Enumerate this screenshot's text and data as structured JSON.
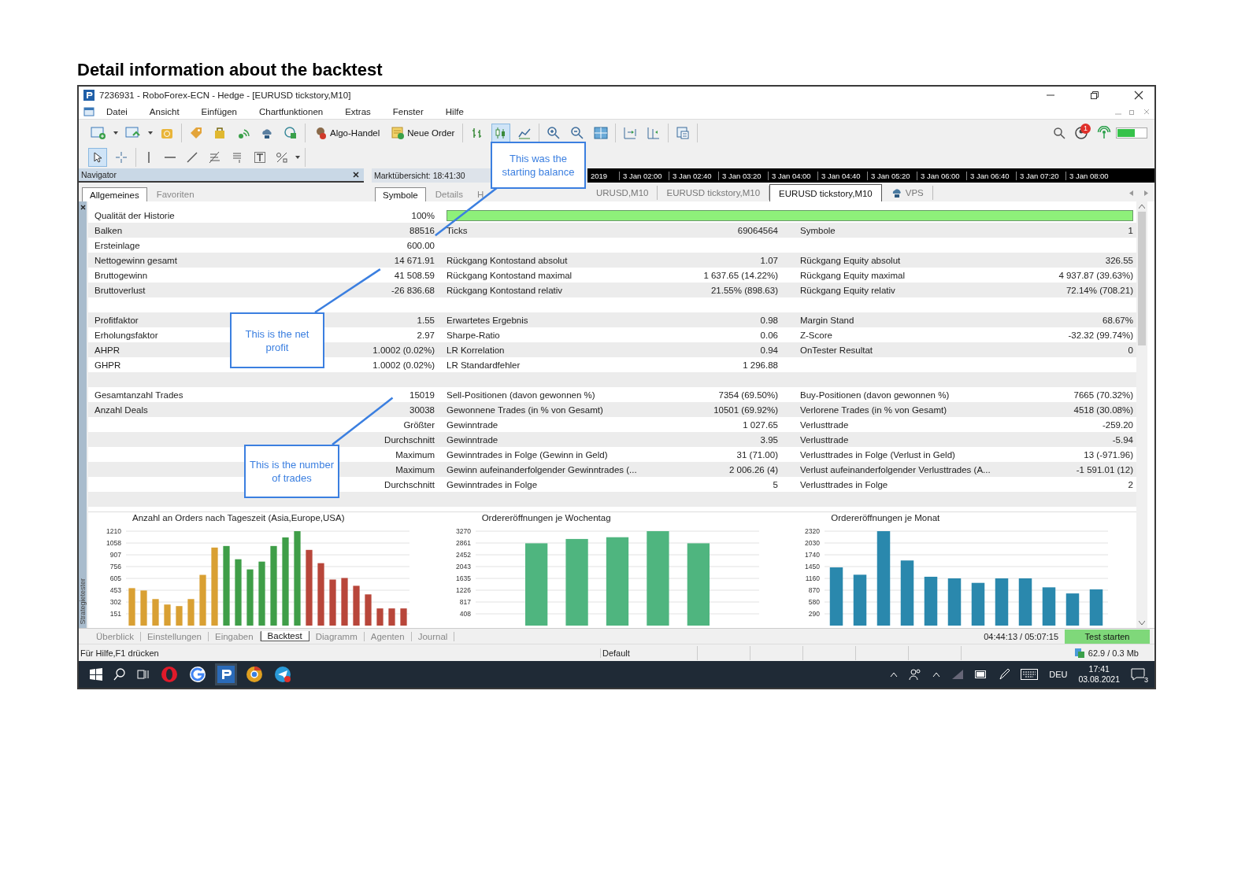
{
  "heading": "Detail information about the backtest",
  "window": {
    "title": "7236931 - RoboForex-ECN - Hedge - [EURUSD tickstory,M10]"
  },
  "menu": [
    "Datei",
    "Ansicht",
    "Einfügen",
    "Chartfunktionen",
    "Extras",
    "Fenster",
    "Hilfe"
  ],
  "toolbar": {
    "buttons": [
      {
        "label": "Algo-Handel"
      },
      {
        "label": "Neue Order"
      }
    ],
    "chart_modes": [
      {
        "selected": false
      },
      {
        "selected": true
      },
      {
        "selected": false
      }
    ],
    "notification_count": "1"
  },
  "drawing_tools": [
    {
      "selected": true
    },
    {
      "selected": false
    }
  ],
  "navigator": {
    "title": "Navigator",
    "tabs": [
      {
        "label": "Allgemeines",
        "selected": true
      },
      {
        "label": "Favoriten",
        "selected": false
      }
    ]
  },
  "market_watch": {
    "title": "Marktübersicht: 18:41:30",
    "tabs": [
      {
        "label": "Symbole",
        "selected": true
      },
      {
        "label": "Details",
        "selected": false
      },
      {
        "label": "H",
        "selected": false
      }
    ]
  },
  "timeline": [
    "2019",
    "3 Jan 02:00",
    "3 Jan 02:40",
    "3 Jan 03:20",
    "3 Jan 04:00",
    "3 Jan 04:40",
    "3 Jan 05:20",
    "3 Jan 06:00",
    "3 Jan 06:40",
    "3 Jan 07:20",
    "3 Jan 08:00"
  ],
  "chart_tabs": [
    {
      "label": "URUSD,M10",
      "selected": false
    },
    {
      "label": "EURUSD tickstory,M10",
      "selected": false
    },
    {
      "label": "EURUSD tickstory,M10",
      "selected": true
    },
    {
      "label": "VPS",
      "selected": false
    }
  ],
  "report": {
    "rows": [
      {
        "kind": "quality",
        "label_1": "Qualität der Historie",
        "value_1": "100%",
        "level": 1
      },
      {
        "kind": "stats",
        "label_1": "Balken",
        "value_1": "88516",
        "label_2": "Ticks",
        "value_2": "69064564",
        "label_3": "Symbole",
        "value_3": "1"
      },
      {
        "kind": "stats",
        "label_1": "Ersteinlage",
        "value_1": "600.00"
      },
      {
        "kind": "stats",
        "label_1": "Nettogewinn gesamt",
        "value_1": "14 671.91",
        "label_2": "Rückgang Kontostand absolut",
        "value_2": "1.07",
        "label_3": "Rückgang Equity absolut",
        "value_3": "326.55"
      },
      {
        "kind": "stats",
        "label_1": "Bruttogewinn",
        "value_1": "41 508.59",
        "label_2": "Rückgang Kontostand maximal",
        "value_2": "1 637.65 (14.22%)",
        "label_3": "Rückgang Equity maximal",
        "value_3": "4 937.87 (39.63%)"
      },
      {
        "kind": "stats",
        "label_1": "Bruttoverlust",
        "value_1": "-26 836.68",
        "label_2": "Rückgang Kontostand relativ",
        "value_2": "21.55% (898.63)",
        "label_3": "Rückgang Equity relativ",
        "value_3": "72.14% (708.21)"
      },
      {
        "kind": "spacer"
      },
      {
        "kind": "stats",
        "label_1": "Profitfaktor",
        "value_1": "1.55",
        "label_2": "Erwartetes Ergebnis",
        "value_2": "0.98",
        "label_3": "Margin Stand",
        "value_3": "68.67%"
      },
      {
        "kind": "stats",
        "label_1": "Erholungsfaktor",
        "value_1": "2.97",
        "label_2": "Sharpe-Ratio",
        "value_2": "0.06",
        "label_3": "Z-Score",
        "value_3": "-32.32 (99.74%)"
      },
      {
        "kind": "stats",
        "label_1": "AHPR",
        "value_1": "1.0002 (0.02%)",
        "label_2": "LR Korrelation",
        "value_2": "0.94",
        "label_3": "OnTester Resultat",
        "value_3": "0"
      },
      {
        "kind": "stats",
        "label_1": "GHPR",
        "value_1": "1.0002 (0.02%)",
        "label_2": "LR Standardfehler",
        "value_2": "1 296.88"
      },
      {
        "kind": "spacer"
      },
      {
        "kind": "stats",
        "label_1": "Gesamtanzahl Trades",
        "value_1": "15019",
        "label_2": "Sell-Positionen (davon gewonnen %)",
        "value_2": "7354 (69.50%)",
        "label_3": "Buy-Positionen (davon gewonnen %)",
        "value_3": "7665 (70.32%)"
      },
      {
        "kind": "stats",
        "label_1": "Anzahl Deals",
        "value_1": "30038",
        "label_2": "Gewonnene Trades (in % von Gesamt)",
        "value_2": "10501 (69.92%)",
        "label_3": "Verlorene Trades (in % von Gesamt)",
        "value_3": "4518 (30.08%)"
      },
      {
        "kind": "stats",
        "value_1": "Größter",
        "label_2": "Gewinntrade",
        "value_2": "1 027.65",
        "label_3": "Verlusttrade",
        "value_3": "-259.20"
      },
      {
        "kind": "stats",
        "value_1": "Durchschnitt",
        "label_2": "Gewinntrade",
        "value_2": "3.95",
        "label_3": "Verlusttrade",
        "value_3": "-5.94"
      },
      {
        "kind": "stats",
        "value_1": "Maximum",
        "label_2": "Gewinntrades in Folge (Gewinn in Geld)",
        "value_2": "31 (71.00)",
        "label_3": "Verlusttrades in Folge (Verlust in Geld)",
        "value_3": "13 (-971.96)"
      },
      {
        "kind": "stats",
        "value_1": "Maximum",
        "label_2": "Gewinn aufeinanderfolgender Gewinntrades (...",
        "value_2": "2 006.26 (4)",
        "label_3": "Verlust aufeinanderfolgender Verlusttrades (A...",
        "value_3": "-1 591.01 (12)"
      },
      {
        "kind": "stats",
        "value_1": "Durchschnitt",
        "label_2": "Gewinntrades in Folge",
        "value_2": "5",
        "label_3": "Verlusttrades in Folge",
        "value_3": "2"
      },
      {
        "kind": "spacer"
      }
    ]
  },
  "charts": [
    {
      "chart_data": {
        "type": "bar",
        "grid": true,
        "title": "Anzahl an Orders nach Tageszeit (Asia,Europe,USA)",
        "ylim": [
          0,
          1210
        ],
        "yticks": [
          151,
          302,
          453,
          605,
          756,
          907,
          1058,
          1210
        ],
        "series": [
          {
            "color": "#d9a033",
            "values": [
              480,
              450,
              340,
              270,
              250,
              340,
              650,
              1000,
              null,
              null,
              null,
              null,
              null,
              null,
              null,
              null,
              null,
              null,
              null,
              null,
              null,
              null,
              null,
              null
            ]
          },
          {
            "color": "#3f9e48",
            "values": [
              null,
              null,
              null,
              null,
              null,
              null,
              null,
              null,
              1020,
              850,
              720,
              820,
              1020,
              1130,
              1210,
              null,
              null,
              null,
              null,
              null,
              null,
              null,
              null,
              null
            ]
          },
          {
            "color": "#b8463a",
            "values": [
              null,
              null,
              null,
              null,
              null,
              null,
              null,
              null,
              null,
              null,
              null,
              null,
              null,
              null,
              null,
              970,
              800,
              590,
              610,
              510,
              400,
              220,
              220,
              220
            ]
          }
        ]
      }
    },
    {
      "chart_data": {
        "type": "bar",
        "grid": true,
        "title": "Ordereröffnungen je Wochentag",
        "ylim": [
          0,
          3270
        ],
        "yticks": [
          408,
          817,
          1226,
          1635,
          2043,
          2452,
          2861,
          3270
        ],
        "series": [
          {
            "color": "#4fb57f",
            "values": [
              null,
              2850,
              3000,
              3060,
              3270,
              2850,
              null
            ]
          }
        ]
      }
    },
    {
      "chart_data": {
        "type": "bar",
        "grid": true,
        "title": "Ordereröffnungen je Monat",
        "ylim": [
          0,
          2320
        ],
        "yticks": [
          290,
          580,
          870,
          1160,
          1450,
          1740,
          2030,
          2320
        ],
        "series": [
          {
            "color": "#2a88ad",
            "values": [
              1430,
              1250,
              2320,
              1600,
              1200,
              1160,
              1050,
              1160,
              1160,
              940,
              790,
              890
            ]
          }
        ]
      }
    }
  ],
  "tester": {
    "side_label": "Strategietester",
    "tabs": [
      {
        "label": "Überblick",
        "selected": false
      },
      {
        "label": "Einstellungen",
        "selected": false
      },
      {
        "label": "Eingaben",
        "selected": false
      },
      {
        "label": "Backtest",
        "selected": true
      },
      {
        "label": "Diagramm",
        "selected": false
      },
      {
        "label": "Agenten",
        "selected": false
      },
      {
        "label": "Journal",
        "selected": false
      }
    ],
    "progress": "04:44:13 / 05:07:15",
    "start_button": "Test starten"
  },
  "status_bar": {
    "help": "Für Hilfe,F1 drücken",
    "profile": "Default",
    "traffic": "62.9 / 0.3 Mb"
  },
  "taskbar": {
    "language": "DEU",
    "time": "17:41",
    "date": "03.08.2021",
    "notifications": "3"
  },
  "callouts": [
    {
      "text": "This was the starting balance"
    },
    {
      "text": "This is the net profit"
    },
    {
      "text": "This is the number of trades"
    }
  ]
}
